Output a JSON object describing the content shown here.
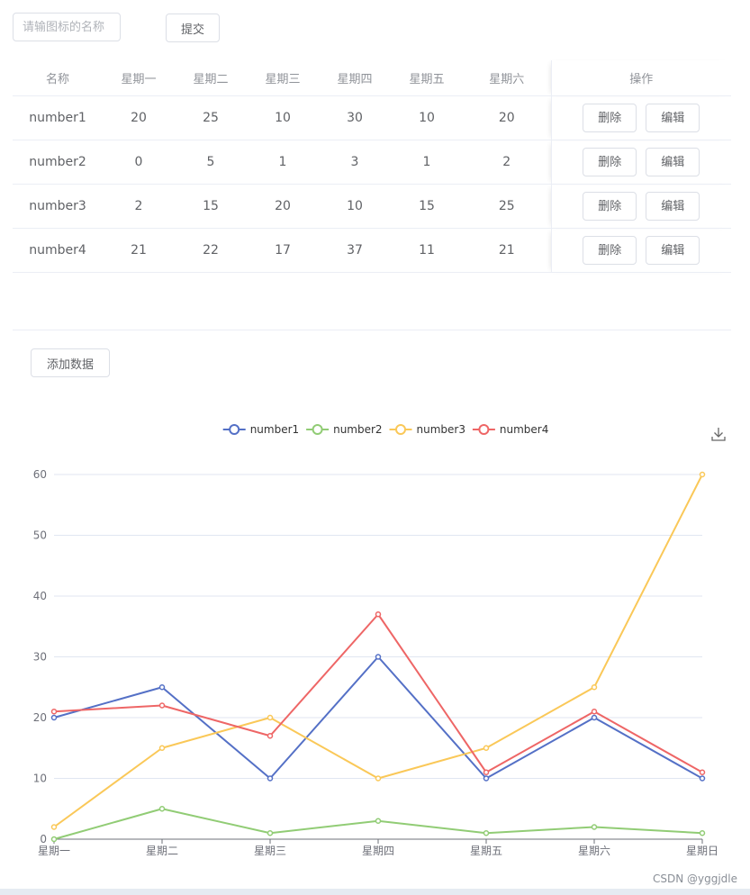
{
  "search": {
    "placeholder": "请输图标的名称"
  },
  "submit_label": "提交",
  "table": {
    "headers": {
      "name": "名称",
      "days": [
        "星期一",
        "星期二",
        "星期三",
        "星期四",
        "星期五",
        "星期六"
      ],
      "ops": "操作"
    },
    "delete_label": "删除",
    "edit_label": "编辑",
    "rows": [
      {
        "name": "number1",
        "values": [
          "20",
          "25",
          "10",
          "30",
          "10",
          "20"
        ]
      },
      {
        "name": "number2",
        "values": [
          "0",
          "5",
          "1",
          "3",
          "1",
          "2"
        ]
      },
      {
        "name": "number3",
        "values": [
          "2",
          "15",
          "20",
          "10",
          "15",
          "25"
        ]
      },
      {
        "name": "number4",
        "values": [
          "21",
          "22",
          "17",
          "37",
          "11",
          "21"
        ]
      }
    ]
  },
  "add_label": "添加数据",
  "chart_data": {
    "type": "line",
    "categories": [
      "星期一",
      "星期二",
      "星期三",
      "星期四",
      "星期五",
      "星期六",
      "星期日"
    ],
    "ylim": [
      0,
      60
    ],
    "yticks": [
      0,
      10,
      20,
      30,
      40,
      50,
      60
    ],
    "grid": true,
    "legend": "top-center",
    "series": [
      {
        "name": "number1",
        "color": "#5470c6",
        "values": [
          20,
          25,
          10,
          30,
          10,
          20,
          10
        ]
      },
      {
        "name": "number2",
        "color": "#91cc75",
        "values": [
          0,
          5,
          1,
          3,
          1,
          2,
          1
        ]
      },
      {
        "name": "number3",
        "color": "#fac858",
        "values": [
          2,
          15,
          20,
          10,
          15,
          25,
          60
        ]
      },
      {
        "name": "number4",
        "color": "#ee6666",
        "values": [
          21,
          22,
          17,
          37,
          11,
          21,
          11
        ]
      }
    ]
  },
  "toolbox": {
    "icon": "download-icon"
  },
  "watermark": "CSDN @yggjdle"
}
